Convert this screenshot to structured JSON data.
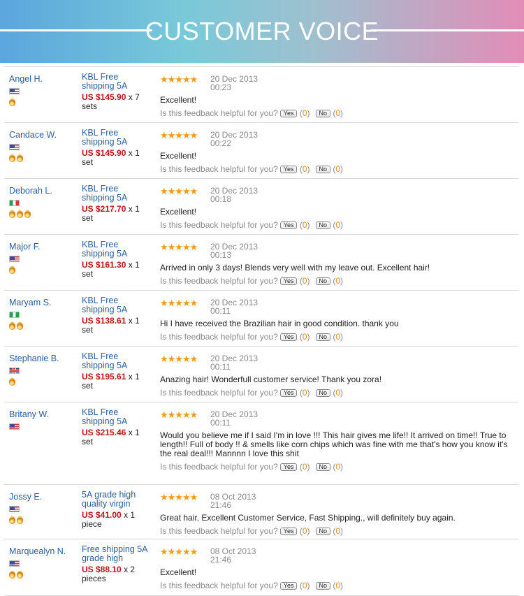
{
  "banner": {
    "title": "CUSTOMER VOICE"
  },
  "helpful_question": "Is this feedback helpful for you?",
  "yes_label": "Yes",
  "no_label": "No",
  "yes_count": "0",
  "no_count": "0",
  "rating": 5,
  "reviews": [
    {
      "buyer": "Angel H.",
      "flag": "us-flag",
      "medals": 1,
      "product": "KBL Free shipping 5A",
      "price": "US $145.90",
      "qty": "x 7",
      "unit": "sets",
      "date": "20 Dec 2013",
      "time": "00:23",
      "comment": "Excellent!"
    },
    {
      "buyer": "Candace W.",
      "flag": "us-flag",
      "medals": 2,
      "product": "KBL Free shipping 5A",
      "price": "US $145.90",
      "qty": "x 1",
      "unit": "set",
      "date": "20 Dec 2013",
      "time": "00:22",
      "comment": "Excellent!"
    },
    {
      "buyer": "Deborah L.",
      "flag": "it-flag",
      "medals": 3,
      "product": "KBL Free shipping 5A",
      "price": "US $217.70",
      "qty": "x 1",
      "unit": "set",
      "date": "20 Dec 2013",
      "time": "00:18",
      "comment": "Excellent!"
    },
    {
      "buyer": "Major F.",
      "flag": "us-flag",
      "medals": 1,
      "product": "KBL Free shipping 5A",
      "price": "US $161.30",
      "qty": "x 1",
      "unit": "set",
      "date": "20 Dec 2013",
      "time": "00:13",
      "comment": "Arrived in only 3 days! Blends very well with my leave out. Excellent hair!"
    },
    {
      "buyer": "Maryam S.",
      "flag": "ng-flag",
      "medals": 2,
      "product": "KBL Free shipping 5A",
      "price": "US $138.61",
      "qty": "x 1",
      "unit": "set",
      "date": "20 Dec 2013",
      "time": "00:11",
      "comment": "Hi I have received the Brazilian hair in good condition. thank you"
    },
    {
      "buyer": "Stephanie B.",
      "flag": "gb-flag",
      "medals": 1,
      "product": "KBL Free shipping 5A",
      "price": "US $195.61",
      "qty": "x 1",
      "unit": "set",
      "date": "20 Dec 2013",
      "time": "00:11",
      "comment": "Anazing hair! Wonderfull customer service! Thank you zora!"
    },
    {
      "buyer": "Britany W.",
      "flag": "us-flag",
      "medals": 0,
      "product": "KBL Free shipping 5A",
      "price": "US $215.46",
      "qty": "x 1",
      "unit": "set",
      "date": "20 Dec 2013",
      "time": "00:11",
      "comment": "Would you believe me if I said I'm in love !!! This hair gives me life!! It arrived on time!! True to length!! Full of body !! & smells like corn chips which was fine with me that's how you know it's the real deal!!! Mannnn I love this shit"
    },
    {
      "buyer": "Jossy E.",
      "flag": "us-flag",
      "medals": 2,
      "product": "5A grade high quality virgin",
      "price": "US $41.00",
      "qty": "x 1",
      "unit": "piece",
      "date": "08 Oct 2013",
      "time": "21:46",
      "comment": "Great hair, Excellent Customer Service, Fast Shipping., will definitely buy again."
    },
    {
      "buyer": "Marquealyn N.",
      "flag": "us-flag",
      "medals": 2,
      "product": "Free shipping 5A grade high",
      "price": "US $88.10",
      "qty": "x 2",
      "unit": "pieces",
      "date": "08 Oct 2013",
      "time": "21:46",
      "comment": "Excellent!"
    }
  ]
}
